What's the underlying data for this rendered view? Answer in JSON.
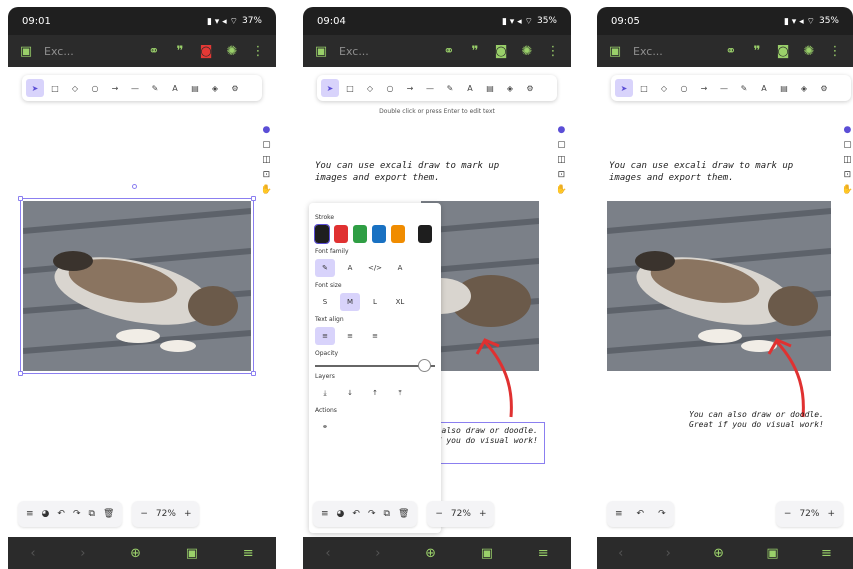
{
  "screens": [
    {
      "status": {
        "time": "09:01",
        "battery": "37%"
      },
      "appbar": {
        "title": "Exc..."
      },
      "zoom": "72%",
      "rec_button_red": true
    },
    {
      "status": {
        "time": "09:04",
        "battery": "35%"
      },
      "appbar": {
        "title": "Exc..."
      },
      "hint": "Double click or press Enter to edit text",
      "note_top": "You can use excali draw to mark up images and export them.",
      "note_bottom": "You can also draw or doodle. Great if you do visual work!",
      "zoom": "72%",
      "panel": {
        "stroke_label": "Stroke",
        "stroke_colors": [
          "#1e1e1e",
          "#e03131",
          "#2f9e44",
          "#1971c2",
          "#f08c00",
          "#1e1e1e"
        ],
        "font_family_label": "Font family",
        "font_family_options": [
          "✎",
          "A",
          "</>",
          "A"
        ],
        "font_size_label": "Font size",
        "font_size_options": [
          "S",
          "M",
          "L",
          "XL"
        ],
        "font_size_selected": "M",
        "text_align_label": "Text align",
        "opacity_label": "Opacity",
        "opacity": 100,
        "layers_label": "Layers",
        "actions_label": "Actions"
      }
    },
    {
      "status": {
        "time": "09:05",
        "battery": "35%"
      },
      "appbar": {
        "title": "Exc..."
      },
      "note_top": "You can use excali draw to mark up images and export them.",
      "note_bottom": "You can also draw or doodle. Great if you do visual work!",
      "zoom": "72%"
    }
  ],
  "colors": {
    "accent": "#9ad06a",
    "selection": "#8b7ff0",
    "tool_active_bg": "#d8d3fb",
    "arrow": "#e03131"
  },
  "icons": [
    "sidebar-icon",
    "link-icon",
    "quote-icon",
    "save-icon",
    "palette-icon",
    "more-icon",
    "hand-icon",
    "rect-icon",
    "diamond-icon",
    "ellipse-icon",
    "arrow-icon",
    "line-icon",
    "pencil-icon",
    "text-icon",
    "image-icon",
    "eraser-icon",
    "library-icon"
  ]
}
